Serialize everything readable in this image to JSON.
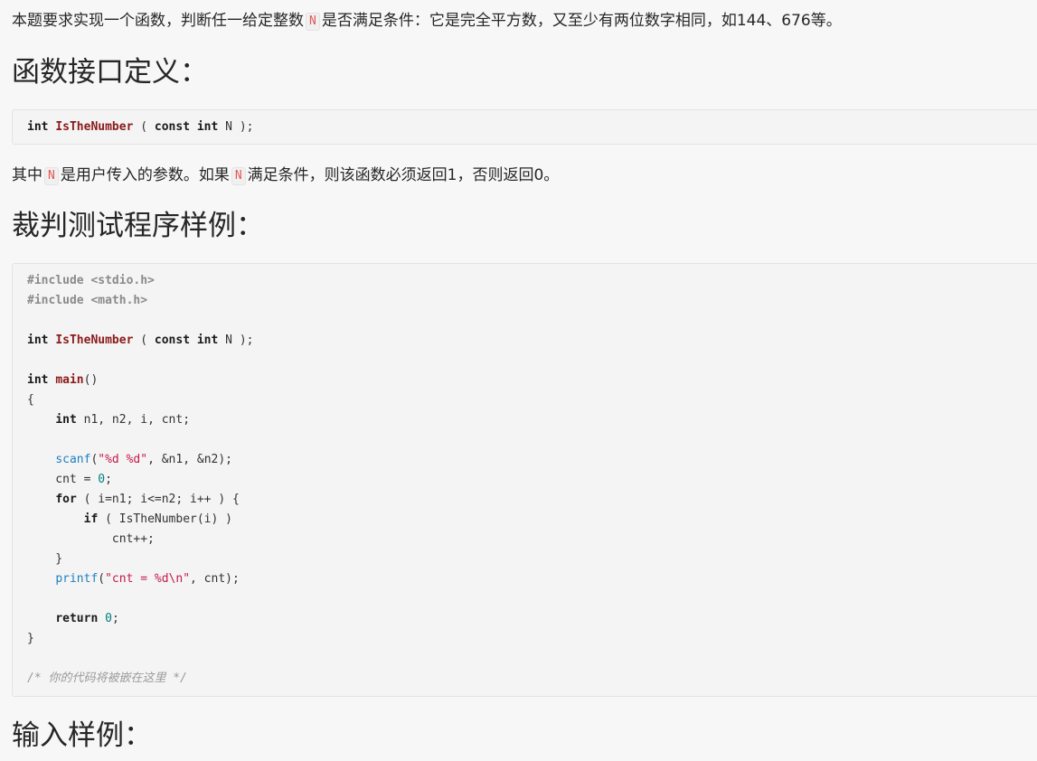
{
  "intro": {
    "before": "本题要求实现一个函数，判断任一给定整数",
    "var": "N",
    "after": "是否满足条件：它是完全平方数，又至少有两位数字相同，如144、676等。"
  },
  "section1": {
    "heading": "函数接口定义："
  },
  "prototype": {
    "type": "int",
    "name": "IsTheNumber",
    "open": " ( ",
    "qual": "const",
    "param_type": "int",
    "rest": " N );"
  },
  "desc": {
    "p1": "其中",
    "v1": "N",
    "p2": "是用户传入的参数。如果",
    "v2": "N",
    "p3": "满足条件，则该函数必须返回1，否则返回0。"
  },
  "section2": {
    "heading": "裁判测试程序样例："
  },
  "sample": {
    "inc1": "#include <stdio.h>",
    "inc2": "#include <math.h>",
    "proto_type": "int",
    "proto_name": "IsTheNumber",
    "proto_open": " ( ",
    "proto_qual": "const",
    "proto_ptype": "int",
    "proto_rest": " N );",
    "main_type": "int",
    "main_name": "main",
    "main_parens": "()",
    "brace_open": "{",
    "decl_indent": "    ",
    "decl_type": "int",
    "decl_rest": " n1, n2, i, cnt;",
    "scanf_indent": "    ",
    "scanf_fn": "scanf",
    "scanf_open": "(",
    "scanf_str": "\"%d %d\"",
    "scanf_rest": ", &n1, &n2);",
    "cnt_text": "    cnt = ",
    "cnt_num": "0",
    "cnt_end": ";",
    "for_indent": "    ",
    "for_kw": "for",
    "for_rest": " ( i=n1; i<=n2; i++ ) {",
    "if_indent": "        ",
    "if_kw": "if",
    "if_rest": " ( IsTheNumber(i) )",
    "inc_line": "            cnt++;",
    "for_close": "    }",
    "printf_indent": "    ",
    "printf_fn": "printf",
    "printf_open": "(",
    "printf_str": "\"cnt = %d\\n\"",
    "printf_rest": ", cnt);",
    "ret_indent": "    ",
    "ret_kw": "return",
    "ret_sp": " ",
    "ret_num": "0",
    "ret_end": ";",
    "brace_close": "}",
    "comment": "/* 你的代码将被嵌在这里 */"
  },
  "section3": {
    "heading": "输入样例："
  }
}
